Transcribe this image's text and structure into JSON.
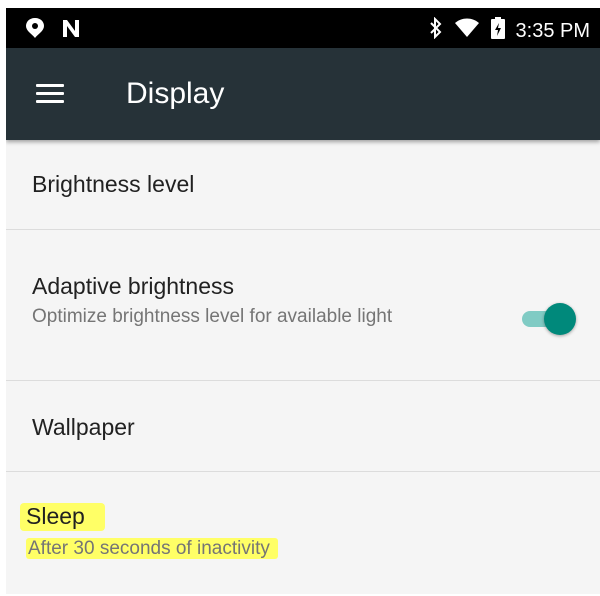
{
  "status_bar": {
    "time": "3:35 PM",
    "left_icons": [
      "location-pin-icon",
      "n-notification-icon"
    ],
    "right_icons": [
      "bluetooth-icon",
      "wifi-icon",
      "battery-icon"
    ]
  },
  "app_bar": {
    "title": "Display",
    "menu_icon": "hamburger-menu-icon",
    "background_color": "#263238"
  },
  "settings": {
    "brightness": {
      "title": "Brightness level"
    },
    "adaptive": {
      "title": "Adaptive brightness",
      "summary": "Optimize brightness level for available light",
      "toggle_on": true
    },
    "wallpaper": {
      "title": "Wallpaper"
    },
    "sleep": {
      "title": "Sleep",
      "summary": "After 30 seconds of inactivity",
      "highlighted": true
    }
  },
  "colors": {
    "accent": "#00897b",
    "accent_track": "#80cbc4",
    "highlight": "#ffff66"
  }
}
